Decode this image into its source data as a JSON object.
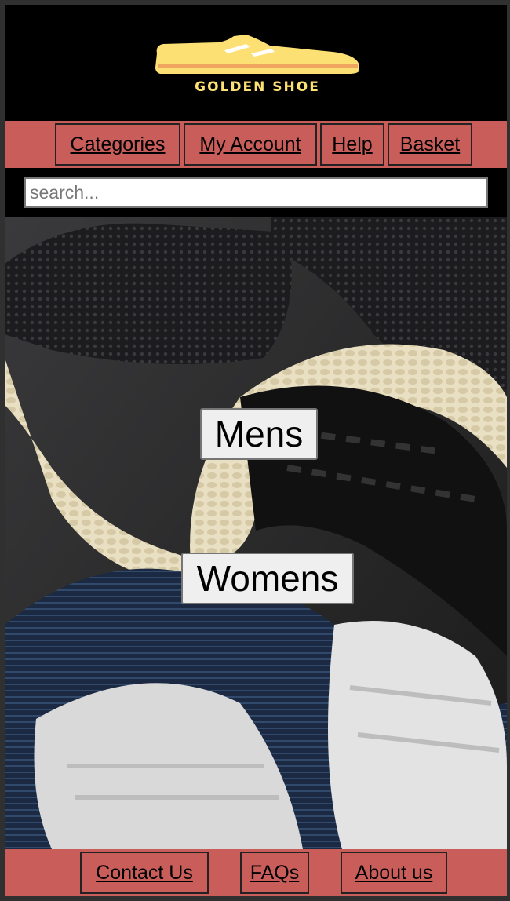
{
  "brand": {
    "name": "GOLDEN SHOE",
    "logo_icon": "shoe-logo-icon",
    "logo_color": "#fde074",
    "logo_stripe_color": "#f0a560"
  },
  "nav": {
    "items": [
      {
        "label": "Categories"
      },
      {
        "label": "My Account"
      },
      {
        "label": "Help"
      },
      {
        "label": "Basket"
      }
    ],
    "background": "#c95d5a"
  },
  "search": {
    "placeholder": "search...",
    "value": ""
  },
  "hero": {
    "buttons": [
      {
        "label": "Mens"
      },
      {
        "label": "Womens"
      }
    ]
  },
  "footer": {
    "items": [
      {
        "label": "Contact Us"
      },
      {
        "label": "FAQs"
      },
      {
        "label": "About us"
      }
    ]
  }
}
